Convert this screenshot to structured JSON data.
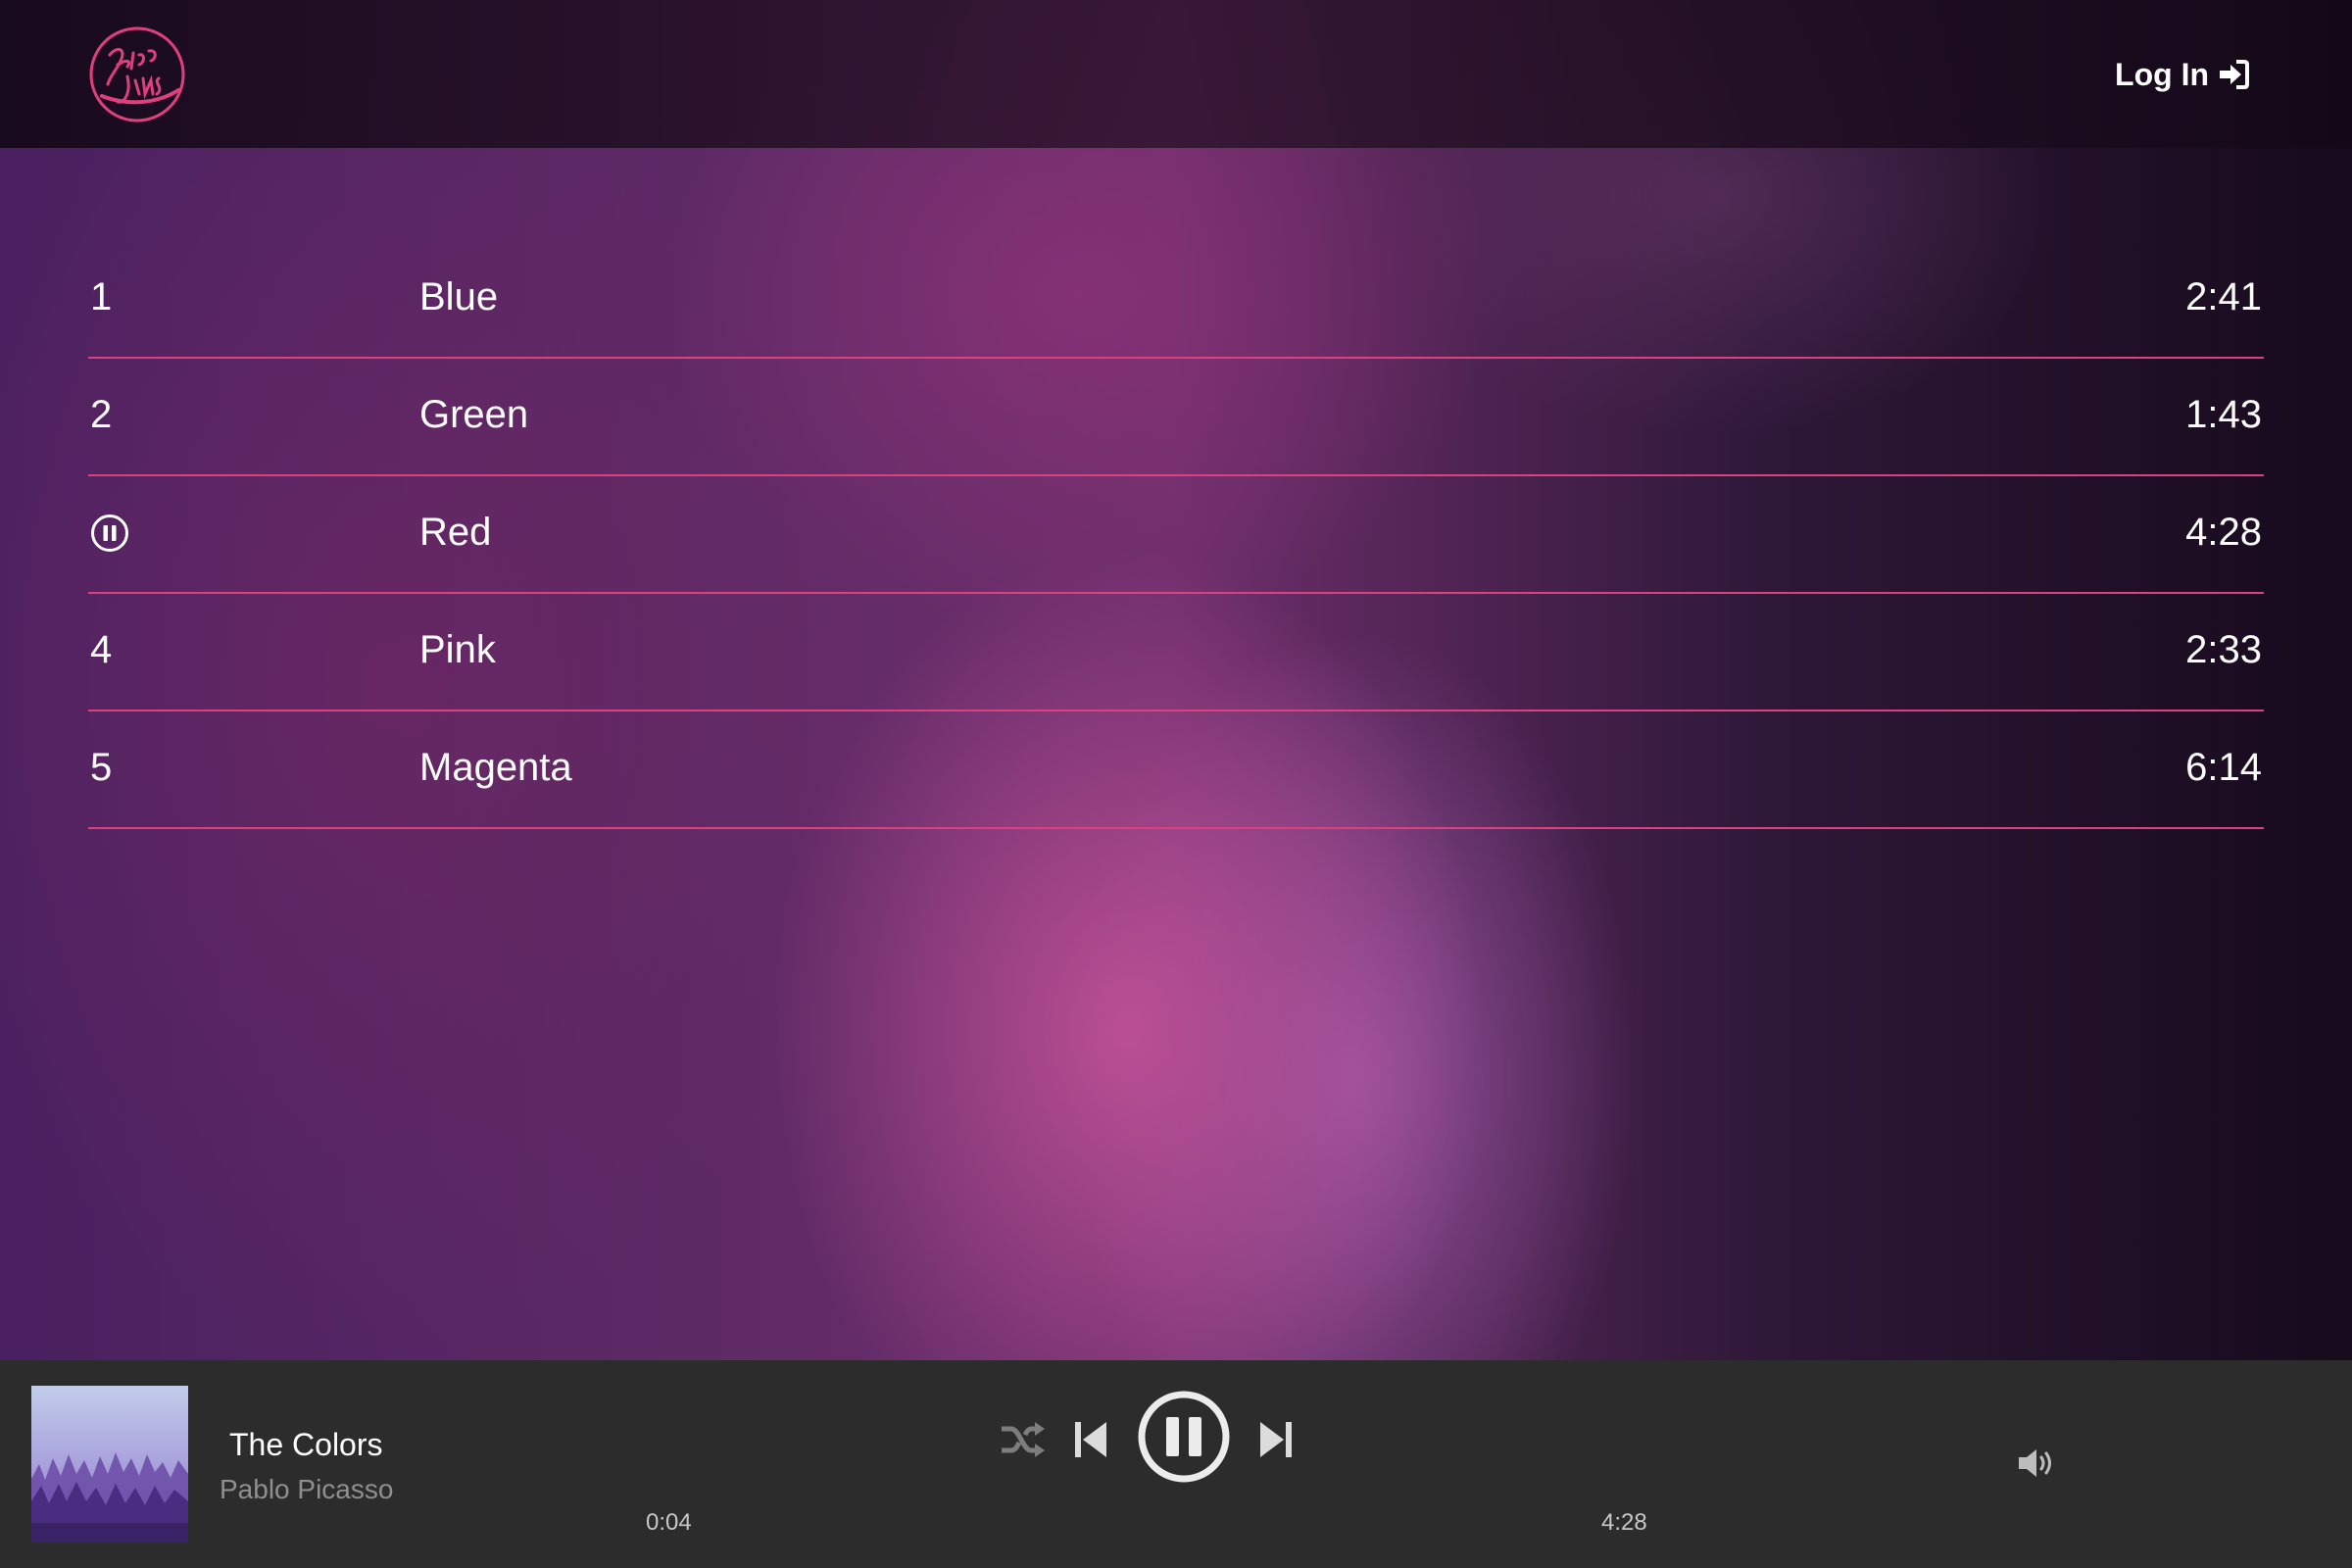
{
  "header": {
    "login_label": "Log In",
    "logo_name": "Bloc Jams"
  },
  "tracks": [
    {
      "number": "1",
      "title": "Blue",
      "duration": "2:41",
      "playing": false
    },
    {
      "number": "2",
      "title": "Green",
      "duration": "1:43",
      "playing": false
    },
    {
      "number": "3",
      "title": "Red",
      "duration": "4:28",
      "playing": true
    },
    {
      "number": "4",
      "title": "Pink",
      "duration": "2:33",
      "playing": false
    },
    {
      "number": "5",
      "title": "Magenta",
      "duration": "6:14",
      "playing": false
    }
  ],
  "player": {
    "song_title": "The Colors",
    "artist": "Pablo Picasso",
    "current_time": "0:04",
    "total_time": "4:28",
    "icons": [
      "shuffle-icon",
      "previous-icon",
      "pause-icon",
      "next-icon",
      "volume-icon"
    ]
  },
  "colors": {
    "accent": "#d9417f",
    "player_bg": "#2c2c2c",
    "muted_text": "#8f8f8f"
  }
}
